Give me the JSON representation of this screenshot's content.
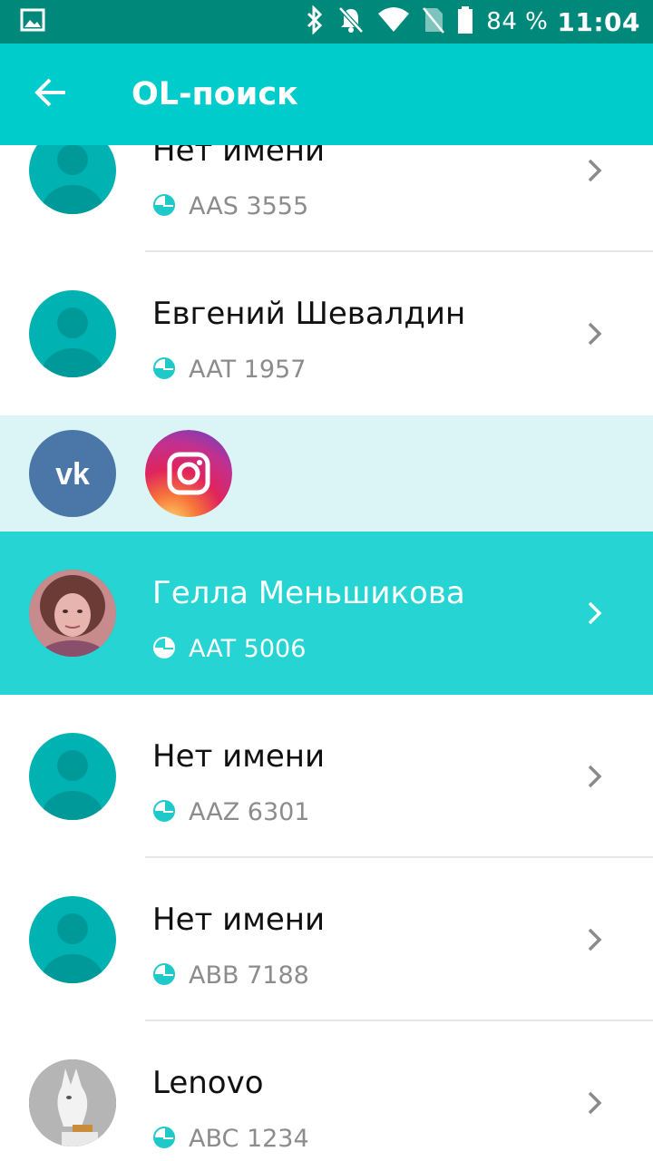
{
  "status_bar": {
    "battery_percent": "84 %",
    "time": "11:04",
    "icons": [
      "image-notification-icon",
      "bluetooth-icon",
      "notifications-off-icon",
      "wifi-icon",
      "no-sim-icon",
      "battery-icon"
    ]
  },
  "app_bar": {
    "title": "OL-поиск",
    "back_icon": "arrow-back-icon"
  },
  "list": {
    "items": [
      {
        "name": "Нет имени",
        "code": "AAS 3555",
        "avatar": "default"
      },
      {
        "name": "Евгений Шевалдин",
        "code": "AAT 1957",
        "avatar": "default"
      },
      {
        "name": "Гелла Меньшикова",
        "code": "AAT 5006",
        "avatar": "photo",
        "selected": true
      },
      {
        "name": "Нет имени",
        "code": "AAZ 6301",
        "avatar": "default"
      },
      {
        "name": "Нет имени",
        "code": "ABB 7188",
        "avatar": "default"
      },
      {
        "name": "Lenovo",
        "code": "ABC 1234",
        "avatar": "photo"
      }
    ]
  },
  "social": {
    "buttons": [
      "vk-icon",
      "instagram-icon"
    ]
  },
  "colors": {
    "status_bar": "#00897b",
    "app_bar": "#00cccc",
    "selected_row": "#26d4d4",
    "social_row": "#dbf4f5",
    "avatar_default": "#00b2b2",
    "vk": "#4a76a8"
  }
}
